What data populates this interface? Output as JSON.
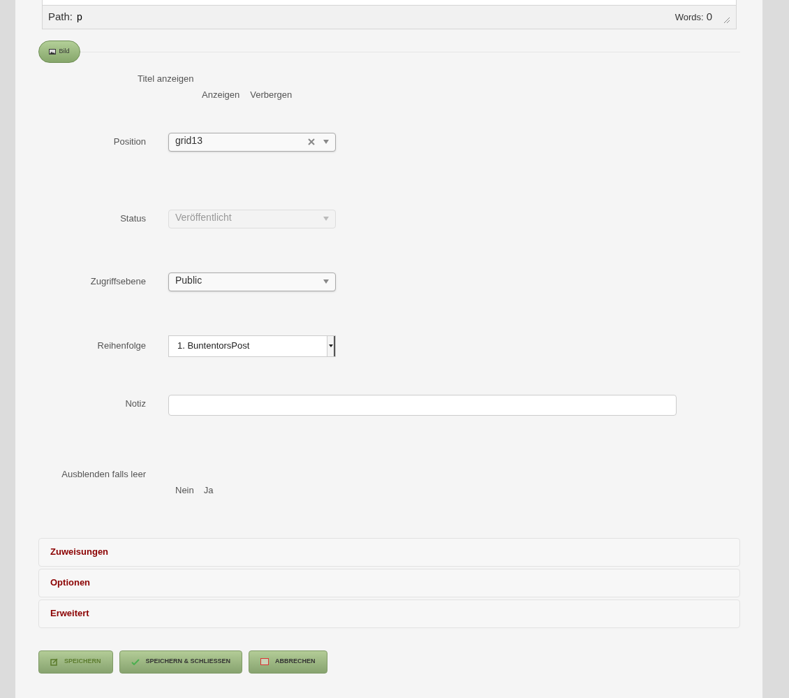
{
  "editor_status": {
    "path_label": "Path:",
    "path_value": "p",
    "words_label": "Words:",
    "words_value": "0"
  },
  "image_button": {
    "label": "Bild"
  },
  "show_title": {
    "label": "Titel anzeigen",
    "options": [
      {
        "label": "Anzeigen"
      },
      {
        "label": "Verbergen"
      }
    ]
  },
  "fields": [
    {
      "label": "Position",
      "kind": "select",
      "value": "grid13",
      "clearable": true,
      "disabled": false
    },
    {
      "label": "Status",
      "kind": "select",
      "value": "Veröffentlicht",
      "clearable": false,
      "disabled": true
    },
    {
      "label": "Zugriffsebene",
      "kind": "select",
      "value": "Public",
      "clearable": false,
      "disabled": false
    },
    {
      "label": "Reihenfolge",
      "kind": "listbox",
      "value": "1. BuntentorsPost"
    },
    {
      "label": "Notiz",
      "kind": "text"
    }
  ],
  "hide_if_empty": {
    "label": "Ausblenden falls leer",
    "options": [
      {
        "label": "Nein"
      },
      {
        "label": "Ja"
      }
    ]
  },
  "panels": [
    {
      "title": "Zuweisungen",
      "expanded": false
    },
    {
      "title": "Optionen",
      "expanded": false
    },
    {
      "title": "Erweitert",
      "expanded": false
    }
  ],
  "buttons": [
    {
      "label": "SPEICHERN",
      "kind": "save"
    },
    {
      "label": "SPEICHERN & SCHLIESSEN",
      "kind": "save-close"
    },
    {
      "label": "ABBRECHEN",
      "kind": "cancel"
    }
  ]
}
